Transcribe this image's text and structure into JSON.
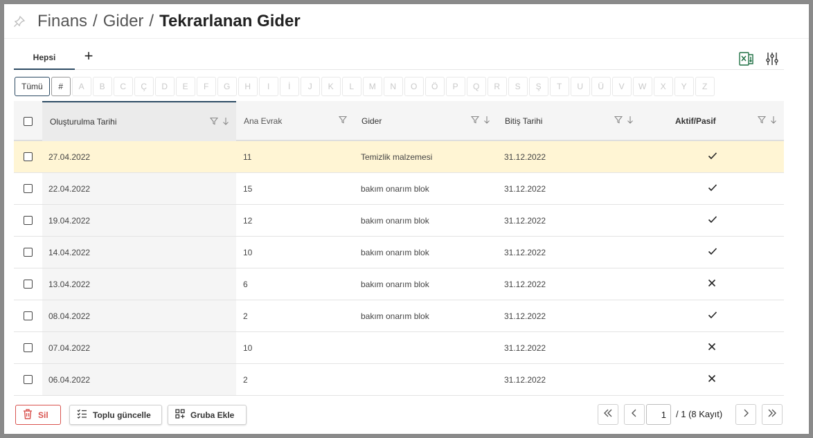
{
  "breadcrumb": {
    "part1": "Finans",
    "part2": "Gider",
    "current": "Tekrarlanan Gider",
    "sep": "/"
  },
  "tabs": {
    "active": "Hepsi",
    "add": "+"
  },
  "letter_filter": [
    "Tümü",
    "#",
    "A",
    "B",
    "C",
    "Ç",
    "D",
    "E",
    "F",
    "G",
    "H",
    "I",
    "İ",
    "J",
    "K",
    "L",
    "M",
    "N",
    "O",
    "Ö",
    "P",
    "Q",
    "R",
    "S",
    "Ş",
    "T",
    "U",
    "Ü",
    "V",
    "W",
    "X",
    "Y",
    "Z"
  ],
  "table": {
    "columns": [
      "Oluşturulma Tarihi",
      "Ana Evrak",
      "Gider",
      "Bitiş Tarihi",
      "Aktif/Pasif"
    ],
    "rows": [
      {
        "created": "27.04.2022",
        "doc": "11",
        "expense": "Temizlik malzemesi",
        "end": "31.12.2022",
        "active": true
      },
      {
        "created": "22.04.2022",
        "doc": "15",
        "expense": "bakım onarım blok",
        "end": "31.12.2022",
        "active": true
      },
      {
        "created": "19.04.2022",
        "doc": "12",
        "expense": "bakım onarım blok",
        "end": "31.12.2022",
        "active": true
      },
      {
        "created": "14.04.2022",
        "doc": "10",
        "expense": "bakım onarım blok",
        "end": "31.12.2022",
        "active": true
      },
      {
        "created": "13.04.2022",
        "doc": "6",
        "expense": "bakım onarım blok",
        "end": "31.12.2022",
        "active": false
      },
      {
        "created": "08.04.2022",
        "doc": "2",
        "expense": "bakım onarım blok",
        "end": "31.12.2022",
        "active": true
      },
      {
        "created": "07.04.2022",
        "doc": "10",
        "expense": "",
        "end": "31.12.2022",
        "active": false
      },
      {
        "created": "06.04.2022",
        "doc": "2",
        "expense": "",
        "end": "31.12.2022",
        "active": false
      }
    ]
  },
  "footer": {
    "delete_label": "Sil",
    "bulk_update_label": "Toplu güncelle",
    "add_group_label": "Gruba Ekle",
    "page_value": "1",
    "page_info": "/ 1 (8 Kayıt)"
  },
  "colors": {
    "accent": "#2c4a63",
    "highlight_row": "#fff5d4",
    "danger": "#d9534f",
    "excel": "#1d6f42"
  },
  "icons": [
    "pin-icon",
    "excel-export-icon",
    "column-settings-icon",
    "filter-icon",
    "sort-down-icon",
    "check-icon",
    "cross-icon",
    "trash-icon",
    "list-check-icon",
    "group-add-icon",
    "first-page-icon",
    "prev-page-icon",
    "next-page-icon",
    "last-page-icon"
  ]
}
